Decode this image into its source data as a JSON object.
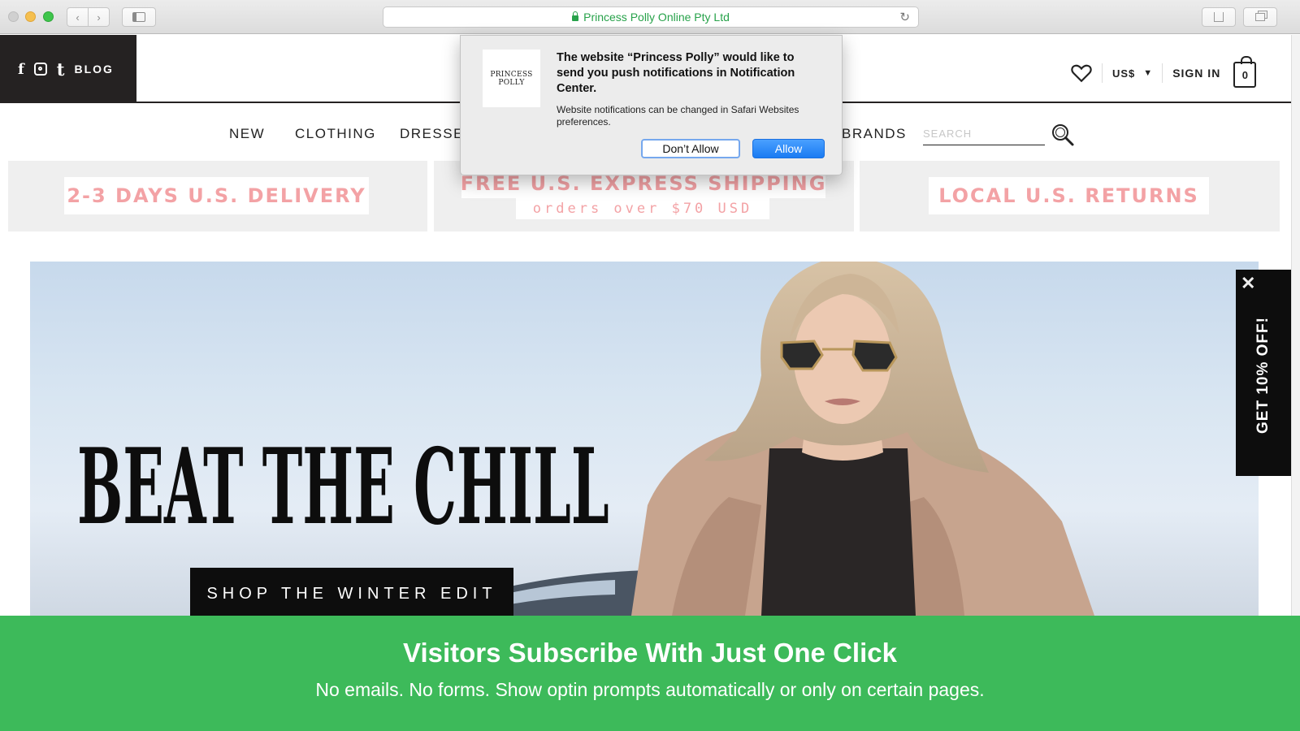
{
  "browser": {
    "address_text": "Princess Polly Online Pty Ltd",
    "colors": {
      "secure_green": "#27a24a"
    }
  },
  "header": {
    "blog_label": "BLOG",
    "currency": "US$",
    "sign_in": "SIGN IN",
    "cart_count": "0"
  },
  "nav": {
    "items": [
      "NEW",
      "CLOTHING",
      "DRESSES",
      "BRANDS"
    ],
    "search_placeholder": "SEARCH"
  },
  "promos": [
    {
      "label": "2-3 DAYS U.S. DELIVERY"
    },
    {
      "label": "FREE U.S. EXPRESS SHIPPING",
      "sub": "orders over $70 USD"
    },
    {
      "label": "LOCAL U.S. RETURNS"
    }
  ],
  "hero": {
    "title": "BEAT THE CHILL",
    "cta": "SHOP THE WINTER EDIT"
  },
  "side_tab": {
    "label": "GET 10% OFF!"
  },
  "notification": {
    "logo_text": "PRINCESS POLLY",
    "title": "The website “Princess Polly” would like to send you push notifications in Notification Center.",
    "body": "Website notifications can be changed in Safari Websites preferences.",
    "dont_allow": "Don’t Allow",
    "allow": "Allow"
  },
  "banner": {
    "headline": "Visitors Subscribe With Just One Click",
    "sub": "No emails. No forms. Show optin prompts automatically or only on certain pages.",
    "color": "#3dba5a"
  },
  "icons": [
    "facebook-icon",
    "instagram-icon",
    "tumblr-icon",
    "heart-icon",
    "cart-icon",
    "search-icon",
    "close-icon",
    "lock-icon",
    "reload-icon"
  ]
}
